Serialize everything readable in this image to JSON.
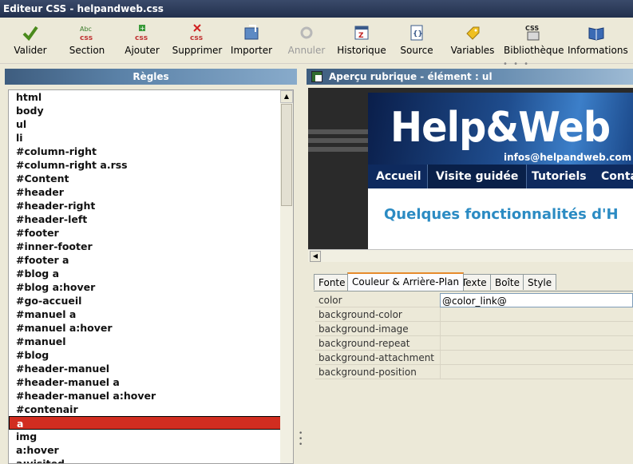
{
  "window": {
    "title": "Editeur CSS - helpandweb.css"
  },
  "toolbar": [
    {
      "label": "Valider",
      "icon": "check-icon",
      "enabled": true
    },
    {
      "label": "Section",
      "icon": "css-section-icon",
      "enabled": true
    },
    {
      "label": "Ajouter",
      "icon": "css-add-icon",
      "enabled": true
    },
    {
      "label": "Supprimer",
      "icon": "css-delete-icon",
      "enabled": true
    },
    {
      "label": "Importer",
      "icon": "import-icon",
      "enabled": true
    },
    {
      "label": "Annuler",
      "icon": "undo-icon",
      "enabled": false
    },
    {
      "label": "Historique",
      "icon": "history-icon",
      "enabled": true
    },
    {
      "label": "Source",
      "icon": "source-icon",
      "enabled": true
    },
    {
      "label": "Variables",
      "icon": "tag-icon",
      "enabled": true
    },
    {
      "label": "Bibliothèque",
      "icon": "library-icon",
      "enabled": true
    },
    {
      "label": "Informations",
      "icon": "book-icon",
      "enabled": true
    }
  ],
  "rules_panel": {
    "title": "Règles",
    "selected": "a",
    "items": [
      "html",
      "body",
      "ul",
      "li",
      "#column-right",
      "#column-right a.rss",
      "#Content",
      "#header",
      "#header-right",
      "#header-left",
      "#footer",
      "#inner-footer",
      "#footer a",
      "#blog a",
      "#blog a:hover",
      "#go-accueil",
      "#manuel a",
      "#manuel a:hover",
      "#manuel",
      "#blog",
      "#header-manuel",
      "#header-manuel a",
      "#header-manuel a:hover",
      "#contenair",
      "a",
      "img",
      "a:hover",
      "a:visited"
    ]
  },
  "preview_panel": {
    "title": "Aperçu rubrique - élément : ul",
    "logo": "Help&Web",
    "email": "infos@helpandweb.com",
    "nav": [
      "Accueil",
      "Visite guidée",
      "Tutoriels",
      "Conta"
    ],
    "active_nav": "Visite guidée",
    "heading": "Quelques fonctionnalités d'H"
  },
  "tabs": [
    {
      "label": "Fonte",
      "active": false
    },
    {
      "label": "Couleur & Arrière-Plan",
      "active": true
    },
    {
      "label": "Texte",
      "active": false
    },
    {
      "label": "Boîte",
      "active": false
    },
    {
      "label": "Style",
      "active": false
    }
  ],
  "properties": [
    {
      "name": "color",
      "value": "@color_link@"
    },
    {
      "name": "background-color",
      "value": ""
    },
    {
      "name": "background-image",
      "value": ""
    },
    {
      "name": "background-repeat",
      "value": ""
    },
    {
      "name": "background-attachment",
      "value": ""
    },
    {
      "name": "background-position",
      "value": ""
    }
  ],
  "colors": {
    "selection": "#d12d20",
    "link_heading": "#2b8bc3",
    "tab_accent": "#e68b2c"
  }
}
